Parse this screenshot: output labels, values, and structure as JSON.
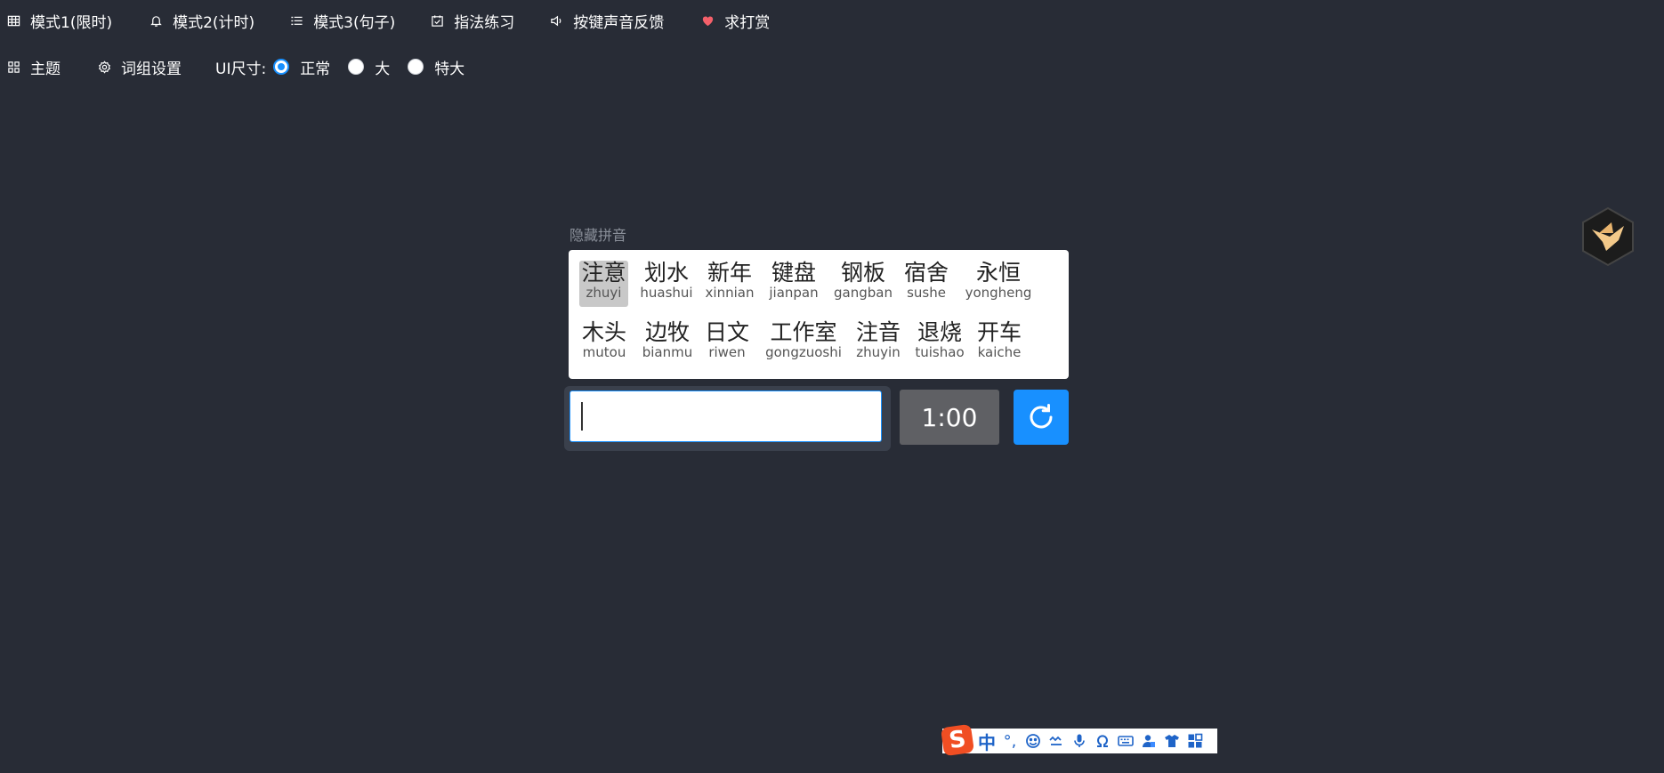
{
  "menu": {
    "row1": [
      {
        "label": "模式1(限时)",
        "icon": "table-icon"
      },
      {
        "label": "模式2(计时)",
        "icon": "bell-icon"
      },
      {
        "label": "模式3(句子)",
        "icon": "list-icon"
      },
      {
        "label": "指法练习",
        "icon": "calendar-check-icon"
      },
      {
        "label": "按键声音反馈",
        "icon": "speaker-icon"
      },
      {
        "label": "求打赏",
        "icon": "heart-icon"
      }
    ],
    "row2": [
      {
        "label": "主题",
        "icon": "grid-icon"
      },
      {
        "label": "词组设置",
        "icon": "gear-icon"
      }
    ],
    "ui_size": {
      "label": "UI尺寸:",
      "options": [
        {
          "label": "正常",
          "checked": true
        },
        {
          "label": "大",
          "checked": false
        },
        {
          "label": "特大",
          "checked": false
        }
      ]
    }
  },
  "hide_pinyin_label": "隐藏拼音",
  "words": [
    {
      "hanzi": "注意",
      "pinyin": "zhuyi",
      "active": true
    },
    {
      "hanzi": "划水",
      "pinyin": "huashui"
    },
    {
      "hanzi": "新年",
      "pinyin": "xinnian"
    },
    {
      "hanzi": "键盘",
      "pinyin": "jianpan"
    },
    {
      "hanzi": "钢板",
      "pinyin": "gangban"
    },
    {
      "hanzi": "宿舍",
      "pinyin": "sushe"
    },
    {
      "hanzi": "永恒",
      "pinyin": "yongheng"
    },
    {
      "hanzi": "木头",
      "pinyin": "mutou"
    },
    {
      "hanzi": "边牧",
      "pinyin": "bianmu"
    },
    {
      "hanzi": "日文",
      "pinyin": "riwen"
    },
    {
      "hanzi": "工作室",
      "pinyin": "gongzuoshi"
    },
    {
      "hanzi": "注音",
      "pinyin": "zhuyin"
    },
    {
      "hanzi": "退烧",
      "pinyin": "tuishao"
    },
    {
      "hanzi": "开车",
      "pinyin": "kaiche"
    }
  ],
  "input": {
    "value": "",
    "placeholder": ""
  },
  "timer": "1:00",
  "refresh_icon": "refresh-icon",
  "ime": {
    "logo": "S",
    "mode": "中",
    "punct": "°,",
    "icons": [
      "emoji-icon",
      "handwriting-icon",
      "microphone-icon",
      "omega-icon",
      "keyboard-icon",
      "user-icon",
      "shirt-icon",
      "apps-icon"
    ]
  },
  "colors": {
    "background": "#282c36",
    "accent": "#1890ff",
    "timer_bg": "#5f6064",
    "ime_blue": "#1f64c8",
    "ime_logo": "#f04e23"
  }
}
